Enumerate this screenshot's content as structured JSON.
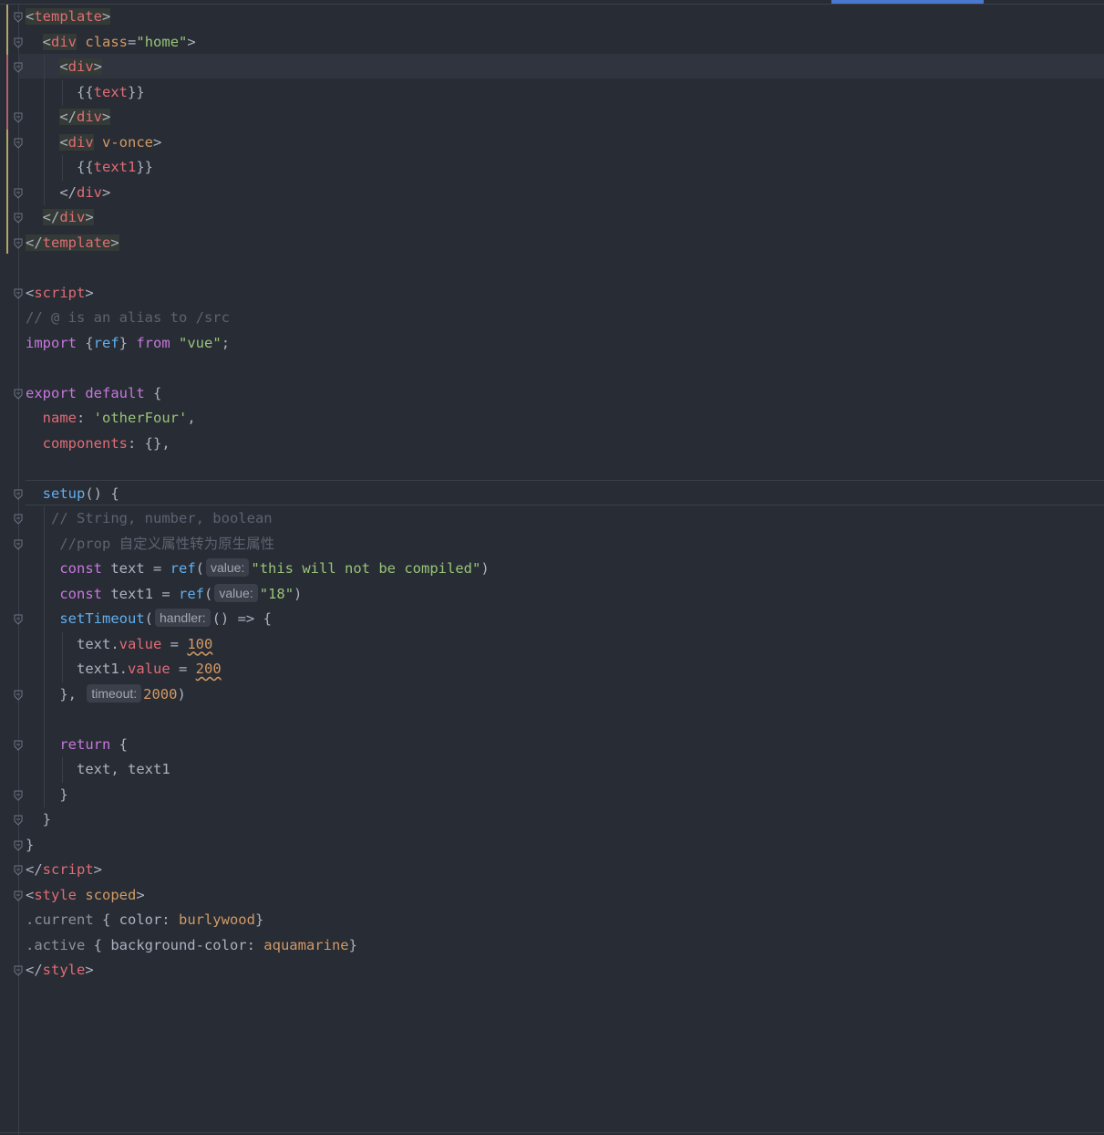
{
  "editor": {
    "lines": [
      {
        "tokens": [
          {
            "c": "punc tagbg",
            "t": "<"
          },
          {
            "c": "tag tagbg",
            "t": "template"
          },
          {
            "c": "punc tagbg",
            "t": ">"
          }
        ]
      },
      {
        "tokens": [
          {
            "c": "punc",
            "t": "  "
          },
          {
            "c": "punc tagbg",
            "t": "<"
          },
          {
            "c": "tag tagbg",
            "t": "div"
          },
          {
            "c": "punc",
            "t": " "
          },
          {
            "c": "attr",
            "t": "class"
          },
          {
            "c": "punc",
            "t": "="
          },
          {
            "c": "attrv",
            "t": "\"home\""
          },
          {
            "c": "punc",
            "t": ">"
          }
        ]
      },
      {
        "tokens": [
          {
            "c": "punc",
            "t": "    "
          },
          {
            "c": "punc tagbg",
            "t": "<"
          },
          {
            "c": "tag tagbg",
            "t": "div"
          },
          {
            "c": "punc tagbg",
            "t": ">"
          }
        ]
      },
      {
        "tokens": [
          {
            "c": "punc",
            "t": "      "
          },
          {
            "c": "punc",
            "t": "{{"
          },
          {
            "c": "prop",
            "t": "text"
          },
          {
            "c": "punc",
            "t": "}}"
          }
        ]
      },
      {
        "tokens": [
          {
            "c": "punc",
            "t": "    "
          },
          {
            "c": "punc tagbg",
            "t": "</"
          },
          {
            "c": "tag tagbg",
            "t": "div"
          },
          {
            "c": "punc tagbg",
            "t": ">"
          }
        ]
      },
      {
        "tokens": [
          {
            "c": "punc",
            "t": "    "
          },
          {
            "c": "punc tagbg",
            "t": "<"
          },
          {
            "c": "tag tagbg",
            "t": "div"
          },
          {
            "c": "punc",
            "t": " "
          },
          {
            "c": "attr",
            "t": "v-once"
          },
          {
            "c": "punc",
            "t": ">"
          }
        ]
      },
      {
        "tokens": [
          {
            "c": "punc",
            "t": "      "
          },
          {
            "c": "punc",
            "t": "{{"
          },
          {
            "c": "prop",
            "t": "text1"
          },
          {
            "c": "punc",
            "t": "}}"
          }
        ]
      },
      {
        "tokens": [
          {
            "c": "punc",
            "t": "    "
          },
          {
            "c": "punc",
            "t": "</"
          },
          {
            "c": "tag",
            "t": "div"
          },
          {
            "c": "punc",
            "t": ">"
          }
        ]
      },
      {
        "tokens": [
          {
            "c": "punc",
            "t": "  "
          },
          {
            "c": "punc tagbg",
            "t": "</"
          },
          {
            "c": "tag tagbg",
            "t": "div"
          },
          {
            "c": "punc tagbg",
            "t": ">"
          }
        ]
      },
      {
        "tokens": [
          {
            "c": "punc tagbg",
            "t": "</"
          },
          {
            "c": "tag tagbg",
            "t": "template"
          },
          {
            "c": "punc tagbg",
            "t": ">"
          }
        ]
      },
      {
        "tokens": []
      },
      {
        "tokens": [
          {
            "c": "punc",
            "t": "<"
          },
          {
            "c": "tag",
            "t": "script"
          },
          {
            "c": "punc",
            "t": ">"
          }
        ]
      },
      {
        "tokens": [
          {
            "c": "com",
            "t": "// @ is an alias to /src"
          }
        ]
      },
      {
        "tokens": [
          {
            "c": "kw",
            "t": "import"
          },
          {
            "c": "punc",
            "t": " {"
          },
          {
            "c": "fn",
            "t": "ref"
          },
          {
            "c": "punc",
            "t": "} "
          },
          {
            "c": "kw",
            "t": "from"
          },
          {
            "c": "punc",
            "t": " "
          },
          {
            "c": "str",
            "t": "\"vue\""
          },
          {
            "c": "punc",
            "t": ";"
          }
        ]
      },
      {
        "tokens": []
      },
      {
        "tokens": [
          {
            "c": "kw",
            "t": "export"
          },
          {
            "c": "punc",
            "t": " "
          },
          {
            "c": "kw",
            "t": "default"
          },
          {
            "c": "punc",
            "t": " {"
          }
        ]
      },
      {
        "tokens": [
          {
            "c": "punc",
            "t": "  "
          },
          {
            "c": "field",
            "t": "name"
          },
          {
            "c": "punc",
            "t": ": "
          },
          {
            "c": "str",
            "t": "'otherFour'"
          },
          {
            "c": "punc",
            "t": ","
          }
        ]
      },
      {
        "tokens": [
          {
            "c": "punc",
            "t": "  "
          },
          {
            "c": "field",
            "t": "components"
          },
          {
            "c": "punc",
            "t": ": {},"
          }
        ]
      },
      {
        "tokens": []
      },
      {
        "tokens": [
          {
            "c": "punc",
            "t": "  "
          },
          {
            "c": "fn",
            "t": "setup"
          },
          {
            "c": "punc",
            "t": "() {"
          }
        ]
      },
      {
        "tokens": [
          {
            "c": "punc",
            "t": "   "
          },
          {
            "c": "com",
            "t": "// String, number, boolean"
          }
        ]
      },
      {
        "tokens": [
          {
            "c": "punc",
            "t": "    "
          },
          {
            "c": "com",
            "t": "//prop 自定义属性转为原生属性"
          }
        ]
      },
      {
        "tokens": [
          {
            "c": "punc",
            "t": "    "
          },
          {
            "c": "kw",
            "t": "const"
          },
          {
            "c": "ident",
            "t": " text = "
          },
          {
            "c": "fn",
            "t": "ref"
          },
          {
            "c": "punc",
            "t": "("
          },
          {
            "hint": "value:"
          },
          {
            "c": "str",
            "t": "\"this will not be compiled\""
          },
          {
            "c": "punc",
            "t": ")"
          }
        ]
      },
      {
        "tokens": [
          {
            "c": "punc",
            "t": "    "
          },
          {
            "c": "kw",
            "t": "const"
          },
          {
            "c": "ident",
            "t": " text1 = "
          },
          {
            "c": "fn",
            "t": "ref"
          },
          {
            "c": "punc",
            "t": "("
          },
          {
            "hint": "value:"
          },
          {
            "c": "str",
            "t": "\"18\""
          },
          {
            "c": "punc",
            "t": ")"
          }
        ]
      },
      {
        "tokens": [
          {
            "c": "punc",
            "t": "    "
          },
          {
            "c": "fn",
            "t": "setTimeout"
          },
          {
            "c": "punc",
            "t": "("
          },
          {
            "hint": "handler:"
          },
          {
            "c": "punc",
            "t": "() => {"
          }
        ]
      },
      {
        "tokens": [
          {
            "c": "punc",
            "t": "      "
          },
          {
            "c": "ident",
            "t": "text."
          },
          {
            "c": "field",
            "t": "value"
          },
          {
            "c": "punc",
            "t": " = "
          },
          {
            "c": "num-uline",
            "t": "100"
          }
        ]
      },
      {
        "tokens": [
          {
            "c": "punc",
            "t": "      "
          },
          {
            "c": "ident",
            "t": "text1."
          },
          {
            "c": "field",
            "t": "value"
          },
          {
            "c": "punc",
            "t": " = "
          },
          {
            "c": "num-uline",
            "t": "200"
          }
        ]
      },
      {
        "tokens": [
          {
            "c": "punc",
            "t": "    "
          },
          {
            "c": "punc",
            "t": "}, "
          },
          {
            "hint": "timeout:"
          },
          {
            "c": "num",
            "t": "2000"
          },
          {
            "c": "punc",
            "t": ")"
          }
        ]
      },
      {
        "tokens": []
      },
      {
        "tokens": [
          {
            "c": "punc",
            "t": "    "
          },
          {
            "c": "kw",
            "t": "return"
          },
          {
            "c": "punc",
            "t": " {"
          }
        ]
      },
      {
        "tokens": [
          {
            "c": "punc",
            "t": "      "
          },
          {
            "c": "ident",
            "t": "text, text1"
          }
        ]
      },
      {
        "tokens": [
          {
            "c": "punc",
            "t": "    "
          },
          {
            "c": "punc",
            "t": "}"
          }
        ]
      },
      {
        "tokens": [
          {
            "c": "punc",
            "t": "  "
          },
          {
            "c": "punc",
            "t": "}"
          }
        ]
      },
      {
        "tokens": [
          {
            "c": "punc",
            "t": "}"
          }
        ]
      },
      {
        "tokens": [
          {
            "c": "punc",
            "t": "</"
          },
          {
            "c": "tag",
            "t": "script"
          },
          {
            "c": "punc",
            "t": ">"
          }
        ]
      },
      {
        "tokens": [
          {
            "c": "punc",
            "t": "<"
          },
          {
            "c": "tag",
            "t": "style"
          },
          {
            "c": "punc",
            "t": " "
          },
          {
            "c": "attr",
            "t": "scoped"
          },
          {
            "c": "punc",
            "t": ">"
          }
        ]
      },
      {
        "tokens": [
          {
            "c": "sel",
            "t": ".current"
          },
          {
            "c": "punc",
            "t": " { color: "
          },
          {
            "c": "cssval",
            "t": "burlywood"
          },
          {
            "c": "punc",
            "t": "}"
          }
        ]
      },
      {
        "tokens": [
          {
            "c": "sel",
            "t": ".active"
          },
          {
            "c": "punc",
            "t": " { background-color: "
          },
          {
            "c": "cssval",
            "t": "aquamarine"
          },
          {
            "c": "punc",
            "t": "}"
          }
        ]
      },
      {
        "tokens": [
          {
            "c": "punc",
            "t": "</"
          },
          {
            "c": "tag",
            "t": "style"
          },
          {
            "c": "punc",
            "t": ">"
          }
        ]
      }
    ]
  }
}
